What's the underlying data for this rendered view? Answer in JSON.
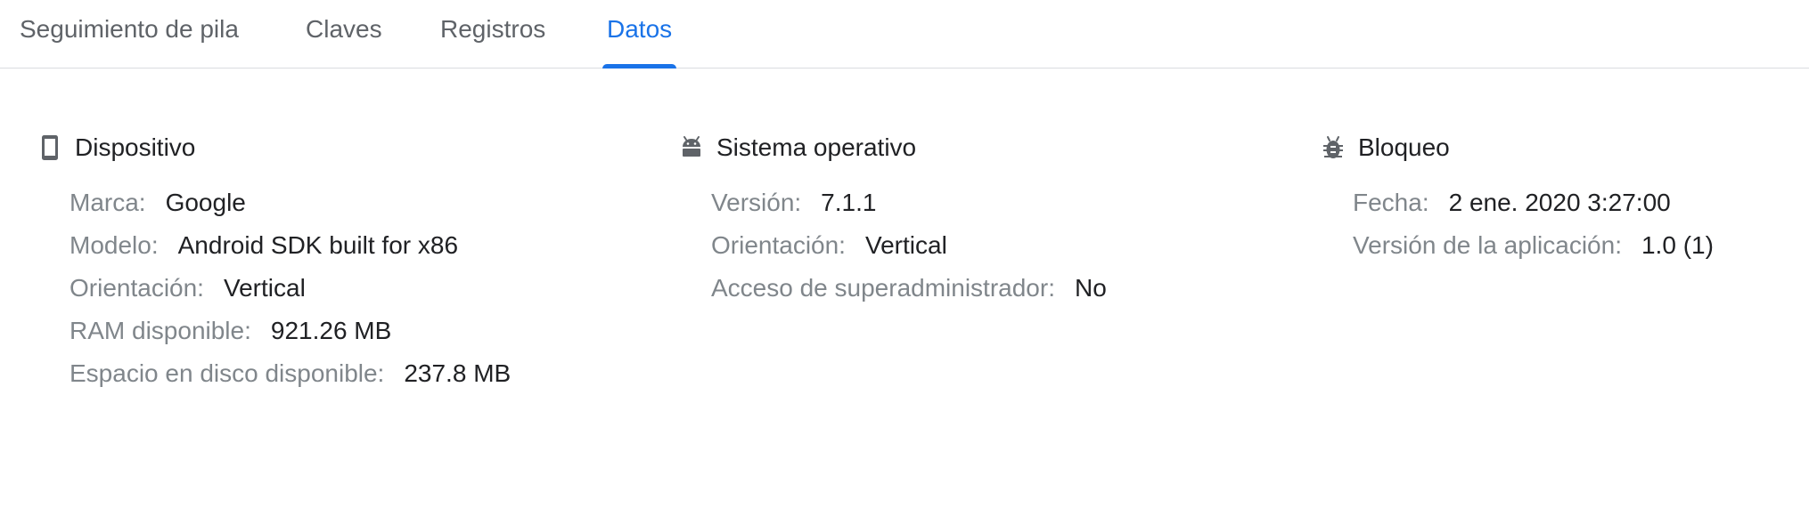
{
  "tabs": [
    {
      "label": "Seguimiento de pila",
      "active": false
    },
    {
      "label": "Claves",
      "active": false
    },
    {
      "label": "Registros",
      "active": false
    },
    {
      "label": "Datos",
      "active": true
    }
  ],
  "sections": {
    "device": {
      "icon": "smartphone-icon",
      "title": "Dispositivo",
      "rows": [
        {
          "label": "Marca:",
          "value": "Google"
        },
        {
          "label": "Modelo:",
          "value": "Android SDK built for x86"
        },
        {
          "label": "Orientación:",
          "value": "Vertical"
        },
        {
          "label": "RAM disponible:",
          "value": "921.26 MB"
        },
        {
          "label": "Espacio en disco disponible:",
          "value": "237.8 MB"
        }
      ]
    },
    "os": {
      "icon": "android-icon",
      "title": "Sistema operativo",
      "rows": [
        {
          "label": "Versión:",
          "value": "7.1.1"
        },
        {
          "label": "Orientación:",
          "value": "Vertical"
        },
        {
          "label": "Acceso de superadministrador:",
          "value": "No"
        }
      ]
    },
    "crash": {
      "icon": "bug-icon",
      "title": "Bloqueo",
      "rows": [
        {
          "label": "Fecha:",
          "value": "2 ene. 2020 3:27:00"
        },
        {
          "label": "Versión de la aplicación:",
          "value": "1.0 (1)"
        }
      ]
    }
  },
  "colors": {
    "accent": "#1a73e8",
    "label": "#80868b",
    "value": "#202124",
    "tab_inactive": "#5f6368",
    "icon": "#5f6368",
    "divider": "#dadce0"
  }
}
